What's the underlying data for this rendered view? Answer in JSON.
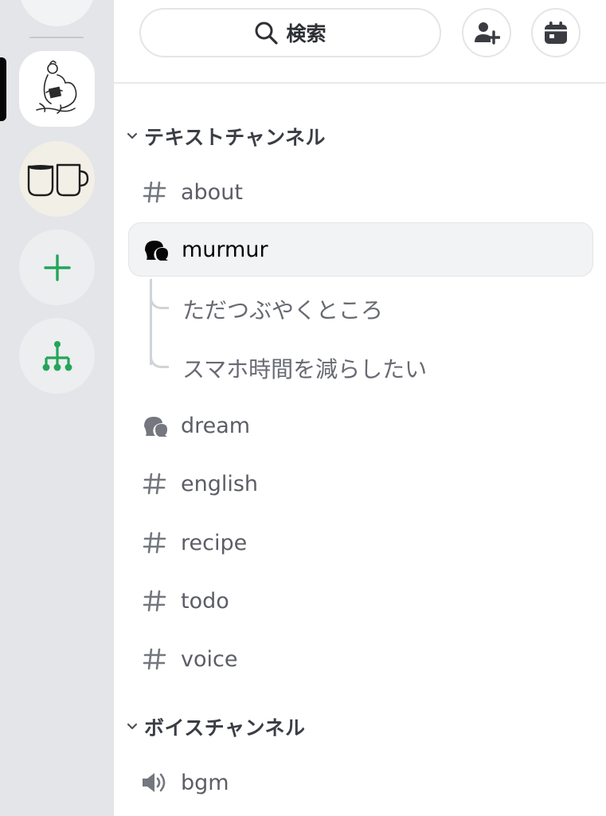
{
  "search": {
    "label": "検索"
  },
  "header_buttons": [
    {
      "icon": "add-member-icon"
    },
    {
      "icon": "calendar-icon"
    }
  ],
  "servers": [
    {
      "icon": "reading-person-icon",
      "selected": true
    },
    {
      "icon": "coffee-mugs-icon"
    },
    {
      "icon": "plus-icon",
      "color": "#23a55a"
    },
    {
      "icon": "hub-icon",
      "color": "#23a55a"
    }
  ],
  "categories": {
    "text": {
      "label": "テキストチャンネル",
      "channels": [
        {
          "name": "about",
          "type": "text"
        },
        {
          "name": "murmur",
          "type": "forum",
          "selected": true,
          "threads": [
            "ただつぶやくところ",
            "スマホ時間を減らしたい"
          ]
        },
        {
          "name": "dream",
          "type": "forum"
        },
        {
          "name": "english",
          "type": "text"
        },
        {
          "name": "recipe",
          "type": "text"
        },
        {
          "name": "todo",
          "type": "text"
        },
        {
          "name": "voice",
          "type": "text"
        }
      ]
    },
    "voice": {
      "label": "ボイスチャンネル",
      "channels": [
        {
          "name": "bgm",
          "type": "voice"
        }
      ]
    }
  },
  "colors": {
    "rail_bg": "#e3e5e8",
    "green_accent": "#23a55a",
    "selected_bg": "#f2f3f5"
  }
}
